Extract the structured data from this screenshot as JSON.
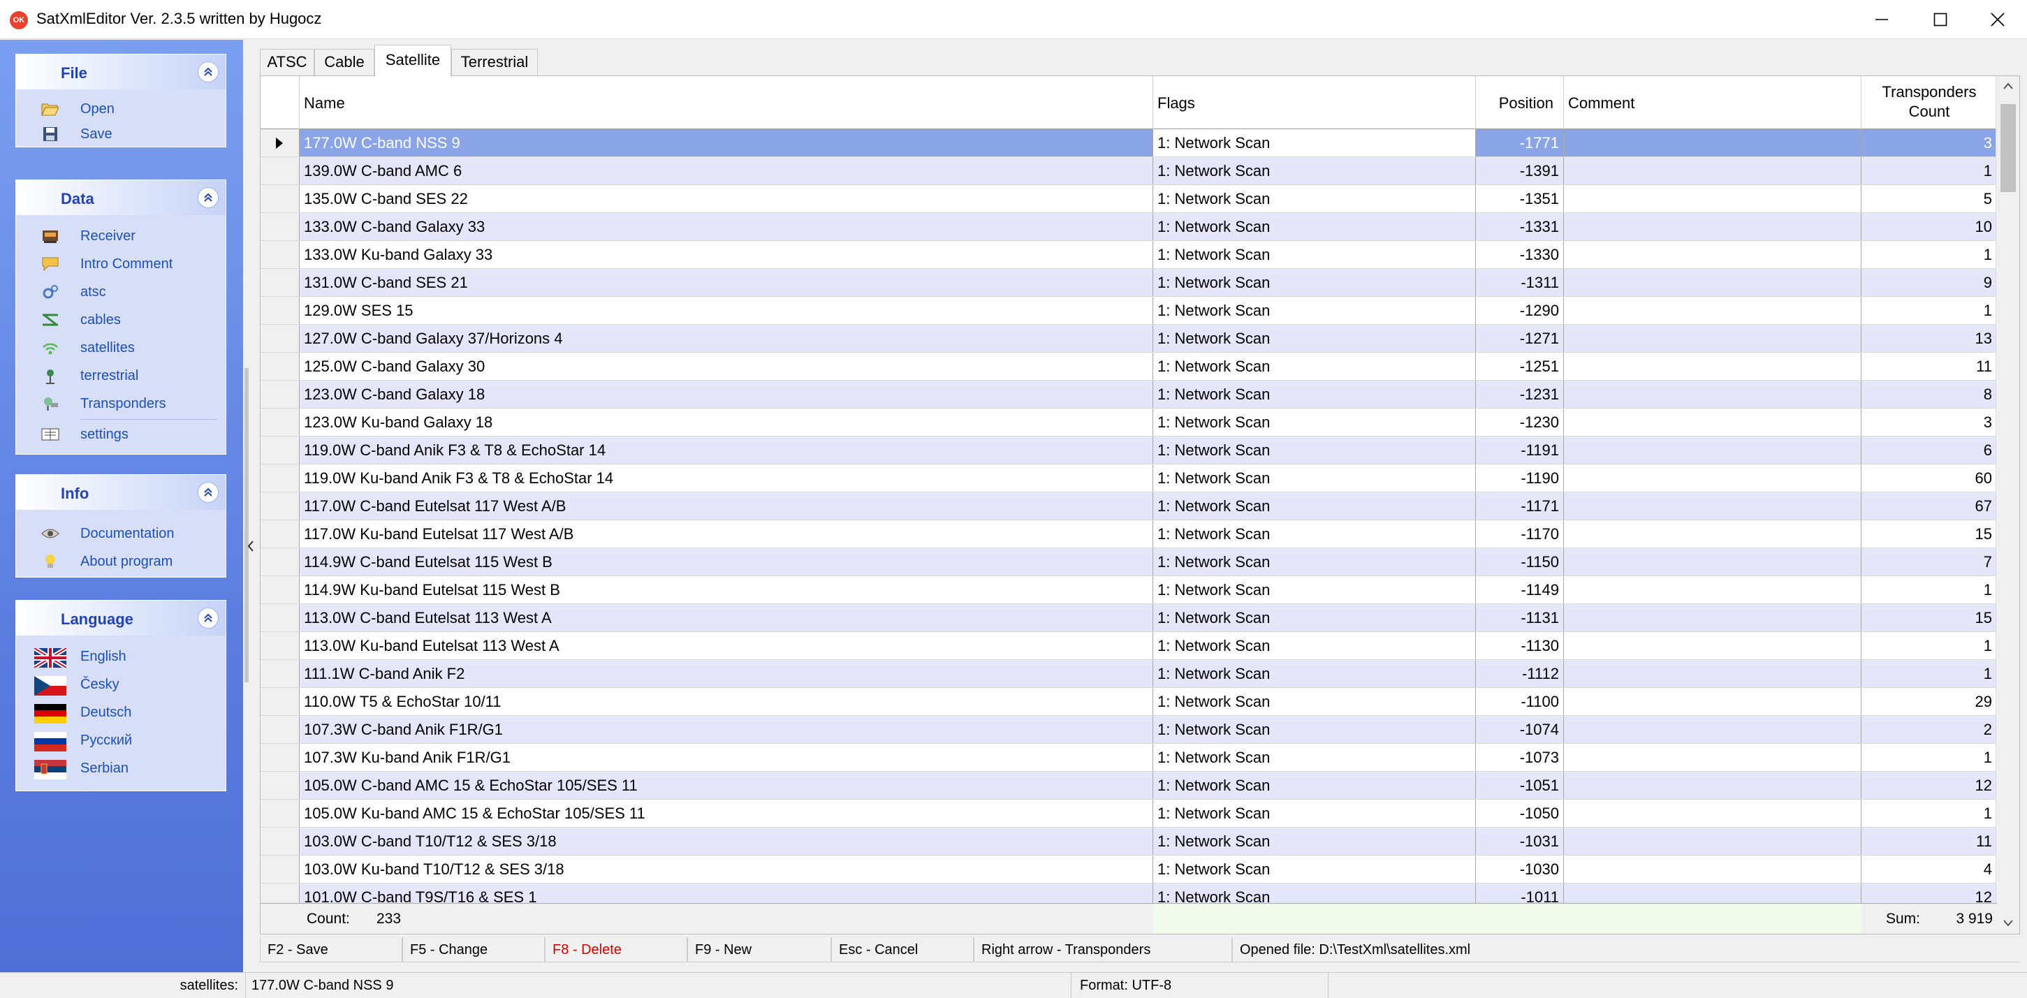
{
  "window": {
    "icon_text": "OK",
    "title": "SatXmlEditor Ver. 2.3.5 written by Hugocz"
  },
  "sidebar": {
    "file": {
      "title": "File",
      "items": [
        {
          "label": "Open",
          "icon": "folder-open-icon"
        },
        {
          "label": "Save",
          "icon": "save-icon"
        }
      ]
    },
    "data": {
      "title": "Data",
      "items": [
        {
          "label": "Receiver",
          "icon": "receiver-icon"
        },
        {
          "label": "Intro Comment",
          "icon": "comment-icon"
        },
        {
          "label": "atsc",
          "icon": "atsc-icon"
        },
        {
          "label": "cables",
          "icon": "cables-icon"
        },
        {
          "label": "satellites",
          "icon": "satellites-icon"
        },
        {
          "label": "terrestrial",
          "icon": "terrestrial-icon"
        },
        {
          "label": "Transponders",
          "icon": "transponders-icon"
        },
        {
          "label": "settings",
          "icon": "settings-icon"
        }
      ]
    },
    "info": {
      "title": "Info",
      "items": [
        {
          "label": "Documentation",
          "icon": "eye-icon"
        },
        {
          "label": "About program",
          "icon": "lightbulb-icon"
        }
      ]
    },
    "language": {
      "title": "Language",
      "items": [
        {
          "label": "English",
          "icon": "flag-uk-icon"
        },
        {
          "label": "Česky",
          "icon": "flag-cz-icon"
        },
        {
          "label": "Deutsch",
          "icon": "flag-de-icon"
        },
        {
          "label": "Русский",
          "icon": "flag-ru-icon"
        },
        {
          "label": "Serbian",
          "icon": "flag-rs-icon"
        }
      ]
    }
  },
  "tabs": [
    "ATSC",
    "Cable",
    "Satellite",
    "Terrestrial"
  ],
  "active_tab": "Satellite",
  "grid": {
    "columns": [
      "Name",
      "Flags",
      "Position",
      "Comment",
      "Transponders",
      "Count"
    ],
    "rows": [
      [
        "177.0W C-band NSS 9",
        "1: Network Scan",
        "-1771",
        "",
        "3"
      ],
      [
        "139.0W C-band AMC 6",
        "1: Network Scan",
        "-1391",
        "",
        "1"
      ],
      [
        "135.0W C-band SES 22",
        "1: Network Scan",
        "-1351",
        "",
        "5"
      ],
      [
        "133.0W C-band Galaxy 33",
        "1: Network Scan",
        "-1331",
        "",
        "10"
      ],
      [
        "133.0W Ku-band Galaxy 33",
        "1: Network Scan",
        "-1330",
        "",
        "1"
      ],
      [
        "131.0W C-band SES 21",
        "1: Network Scan",
        "-1311",
        "",
        "9"
      ],
      [
        "129.0W SES 15",
        "1: Network Scan",
        "-1290",
        "",
        "1"
      ],
      [
        "127.0W C-band Galaxy 37/Horizons 4",
        "1: Network Scan",
        "-1271",
        "",
        "13"
      ],
      [
        "125.0W C-band Galaxy 30",
        "1: Network Scan",
        "-1251",
        "",
        "11"
      ],
      [
        "123.0W C-band Galaxy 18",
        "1: Network Scan",
        "-1231",
        "",
        "8"
      ],
      [
        "123.0W Ku-band Galaxy 18",
        "1: Network Scan",
        "-1230",
        "",
        "3"
      ],
      [
        "119.0W C-band Anik F3 & T8 & EchoStar 14",
        "1: Network Scan",
        "-1191",
        "",
        "6"
      ],
      [
        "119.0W Ku-band Anik F3 & T8 & EchoStar 14",
        "1: Network Scan",
        "-1190",
        "",
        "60"
      ],
      [
        "117.0W C-band Eutelsat 117 West A/B",
        "1: Network Scan",
        "-1171",
        "",
        "67"
      ],
      [
        "117.0W Ku-band Eutelsat 117 West A/B",
        "1: Network Scan",
        "-1170",
        "",
        "15"
      ],
      [
        "114.9W C-band Eutelsat 115 West B",
        "1: Network Scan",
        "-1150",
        "",
        "7"
      ],
      [
        "114.9W Ku-band Eutelsat 115 West B",
        "1: Network Scan",
        "-1149",
        "",
        "1"
      ],
      [
        "113.0W C-band Eutelsat 113 West A",
        "1: Network Scan",
        "-1131",
        "",
        "15"
      ],
      [
        "113.0W Ku-band Eutelsat 113 West A",
        "1: Network Scan",
        "-1130",
        "",
        "1"
      ],
      [
        "111.1W C-band Anik F2",
        "1: Network Scan",
        "-1112",
        "",
        "1"
      ],
      [
        "110.0W T5 & EchoStar 10/11",
        "1: Network Scan",
        "-1100",
        "",
        "29"
      ],
      [
        "107.3W C-band Anik F1R/G1",
        "1: Network Scan",
        "-1074",
        "",
        "2"
      ],
      [
        "107.3W Ku-band Anik F1R/G1",
        "1: Network Scan",
        "-1073",
        "",
        "1"
      ],
      [
        "105.0W C-band AMC 15 & EchoStar 105/SES 11",
        "1: Network Scan",
        "-1051",
        "",
        "12"
      ],
      [
        "105.0W Ku-band AMC 15 & EchoStar 105/SES 11",
        "1: Network Scan",
        "-1050",
        "",
        "1"
      ],
      [
        "103.0W C-band T10/T12 & SES 3/18",
        "1: Network Scan",
        "-1031",
        "",
        "11"
      ],
      [
        "103.0W Ku-band T10/T12 & SES 3/18",
        "1: Network Scan",
        "-1030",
        "",
        "4"
      ],
      [
        "101.0W C-band T9S/T16 & SES 1",
        "1: Network Scan",
        "-1011",
        "",
        "12"
      ]
    ],
    "selected_row": 0,
    "footer": {
      "count_label": "Count:",
      "count_value": "233",
      "sum_label": "Sum:",
      "sum_value": "3 919"
    }
  },
  "hotkeys": [
    {
      "label": "F2 - Save",
      "color": "#000000"
    },
    {
      "label": "F5 - Change",
      "color": "#000000"
    },
    {
      "label": "F8 - Delete",
      "color": "#d40000"
    },
    {
      "label": "F9 - New",
      "color": "#000000"
    },
    {
      "label": "Esc - Cancel",
      "color": "#000000"
    },
    {
      "label": "Right arrow - Transponders",
      "color": "#000000"
    },
    {
      "label": "Opened file: D:\\TestXml\\satellites.xml",
      "color": "#000000"
    }
  ],
  "statusbar": {
    "section_label": "satellites:",
    "current_item": "177.0W C-band NSS 9",
    "format": "Format: UTF-8"
  },
  "colors": {
    "sidebar_top": "#7b9ff0",
    "sidebar_bottom": "#4f6fd6",
    "panel_title": "#2143b5",
    "link": "#1d4fb8",
    "row_alt": "#e6e6fa",
    "row_selected": "#8aa4e8",
    "delete_hotkey": "#d40000"
  }
}
